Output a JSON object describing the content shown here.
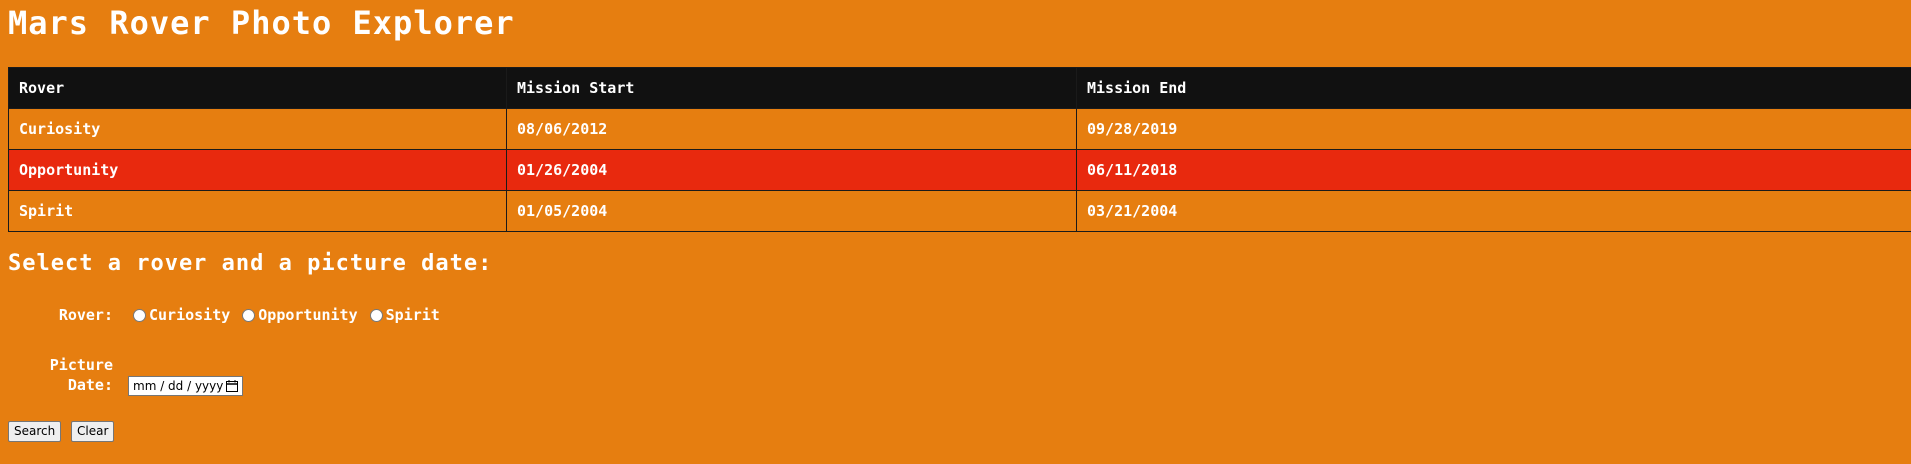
{
  "header": {
    "title": "Mars Rover Photo Explorer"
  },
  "table": {
    "columns": [
      "Rover",
      "Mission Start",
      "Mission End"
    ],
    "rows": [
      {
        "rover": "Curiosity",
        "start": "08/06/2012",
        "end": "09/28/2019"
      },
      {
        "rover": "Opportunity",
        "start": "01/26/2004",
        "end": "06/11/2018"
      },
      {
        "rover": "Spirit",
        "start": "01/05/2004",
        "end": "03/21/2004"
      }
    ],
    "highlighted_row": "Opportunity"
  },
  "form": {
    "heading": "Select a rover and a picture date:",
    "rover_label": "Rover:",
    "rover_options": [
      "Curiosity",
      "Opportunity",
      "Spirit"
    ],
    "date_label_line1": "Picture",
    "date_label_line2": "Date:",
    "date_placeholder": "mm / dd / yyyy",
    "search_label": "Search",
    "clear_label": "Clear"
  },
  "colors": {
    "background": "#e67e10",
    "table_header": "#111111",
    "highlight_row": "#e8290e",
    "text": "#ffffff"
  },
  "icons": {
    "date_picker": "calendar-icon"
  }
}
